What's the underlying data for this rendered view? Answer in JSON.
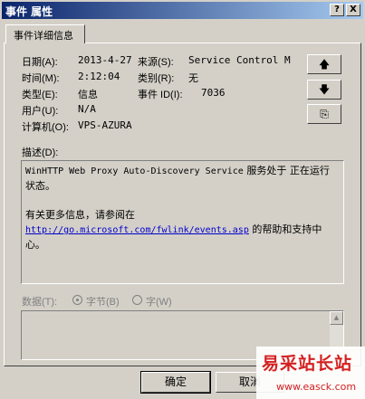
{
  "window": {
    "title": "事件 属性",
    "help_glyph": "?",
    "close_glyph": "X"
  },
  "tab": {
    "label": "事件详细信息"
  },
  "fields": {
    "date_label": "日期(A):",
    "date_value": "2013-4-27",
    "source_label": "来源(S):",
    "source_value": "Service Control M",
    "time_label": "时间(M):",
    "time_value": "2:12:04",
    "category_label": "类别(R):",
    "category_value": "无",
    "type_label": "类型(E):",
    "type_value": "信息",
    "event_id_label": "事件 ID(I):",
    "event_id_value": "7036",
    "user_label": "用户(U):",
    "user_value": "N/A",
    "computer_label": "计算机(O):",
    "computer_value": "VPS-AZURA"
  },
  "side_buttons": {
    "up_glyph": "🡅",
    "down_glyph": "🡇",
    "copy_glyph": "⎘"
  },
  "description": {
    "label": "描述(D):",
    "line1_mono": "WinHTTP Web Proxy Auto-Discovery Service",
    "line1_rest": " 服务处于 正在运行",
    "line2": "状态。",
    "line3": "有关更多信息，请参阅在",
    "link": "http://go.microsoft.com/fwlink/events.asp",
    "line4_rest": " 的帮助和支持中",
    "line5": "心。"
  },
  "data_section": {
    "label": "数据(T):",
    "option_bytes": "字节(B)",
    "option_words": "字(W)"
  },
  "buttons": {
    "ok": "确定",
    "cancel": "取消"
  },
  "watermark": {
    "title": "易采站长站",
    "url": "www.easck.com"
  },
  "colors": {
    "title_bar_start": "#0a246a",
    "title_bar_end": "#a6caf0",
    "dialog_face": "#d4d0c8",
    "link": "#0000cc",
    "watermark": "#d42020"
  }
}
